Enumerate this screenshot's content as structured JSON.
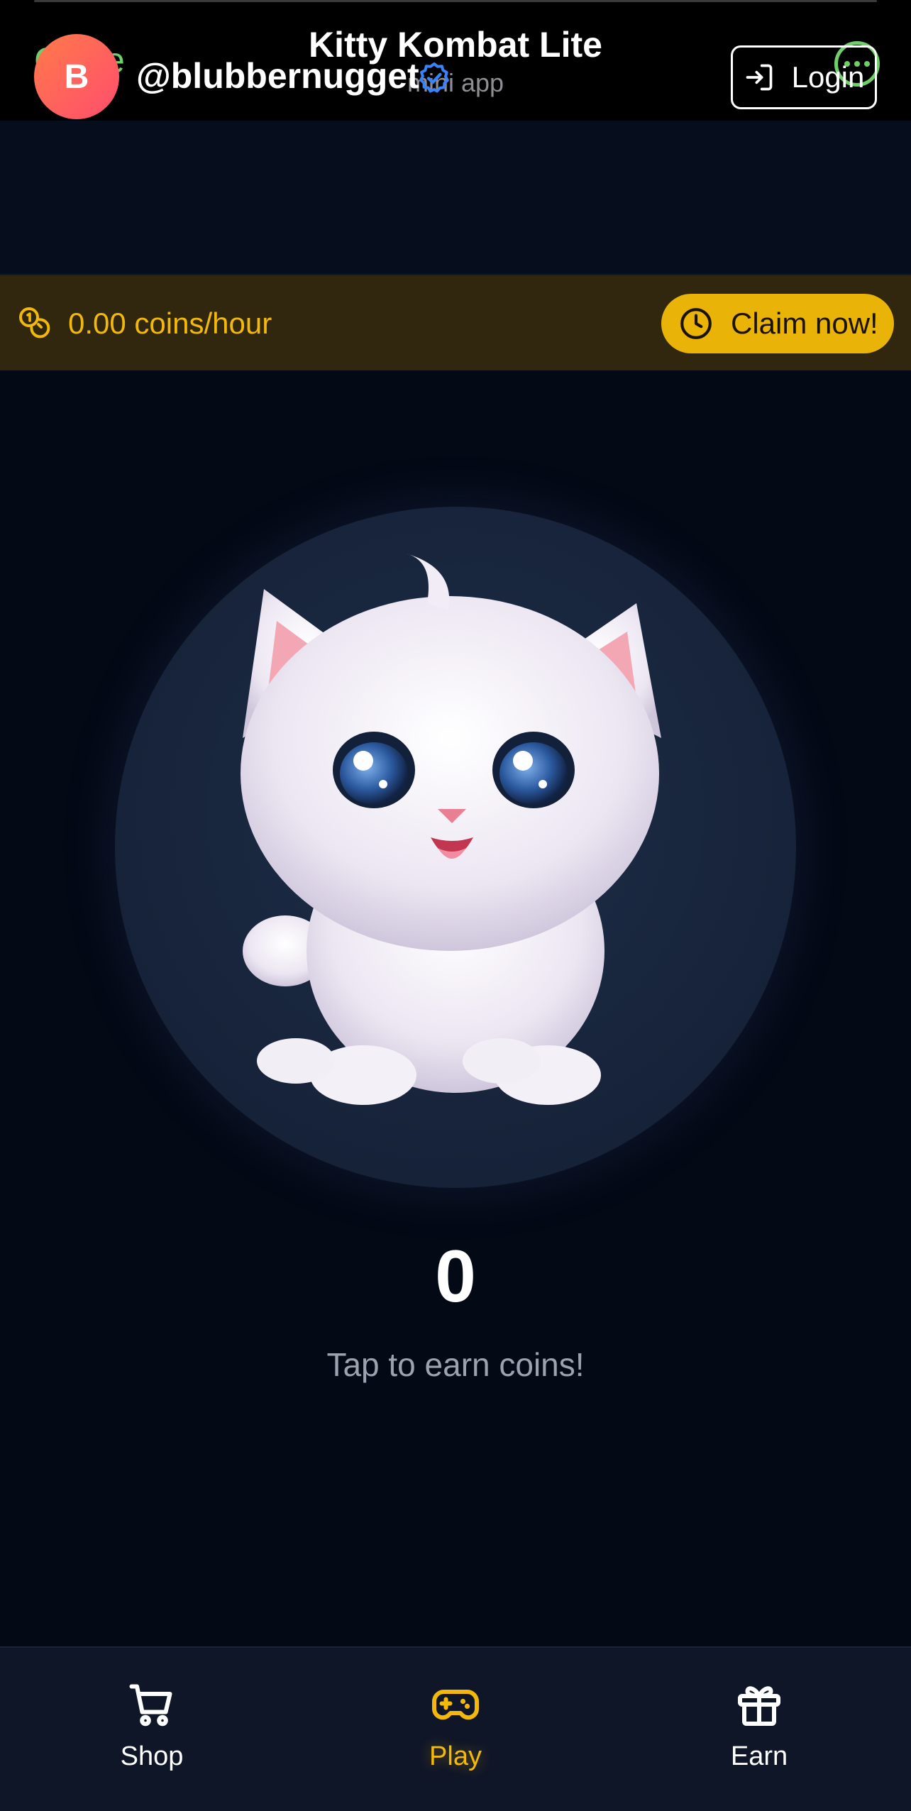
{
  "app": {
    "close_label": "Close",
    "title": "Kitty Kombat Lite",
    "subtitle": "mini app",
    "more_icon": "more-dots-icon",
    "accent_color": "#6fd06a"
  },
  "profile": {
    "avatar_initial": "B",
    "username": "@blubbernugget",
    "verified_icon": "verified-badge-icon",
    "login_label": "Login"
  },
  "banner": {
    "rate_text": "0.00 coins/hour",
    "claim_label": "Claim now!",
    "color": "#eab308"
  },
  "game": {
    "score": "0",
    "hint": "Tap to earn coins!"
  },
  "nav": {
    "items": [
      {
        "label": "Shop",
        "icon": "cart-icon",
        "active": false
      },
      {
        "label": "Play",
        "icon": "gamepad-icon",
        "active": true
      },
      {
        "label": "Earn",
        "icon": "gift-icon",
        "active": false
      }
    ],
    "active_color": "#f2b90c"
  }
}
